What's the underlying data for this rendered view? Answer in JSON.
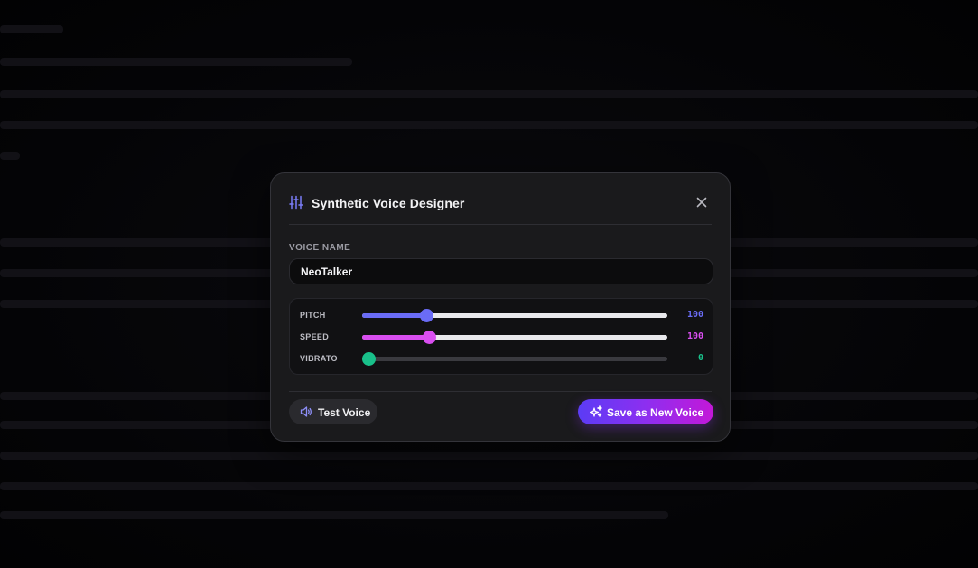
{
  "modal": {
    "title": "Synthetic Voice Designer",
    "title_icon": "sliders-icon",
    "close_icon": "close-icon"
  },
  "voice_name": {
    "label": "VOICE NAME",
    "value": "NeoTalker"
  },
  "sliders": [
    {
      "label": "PITCH",
      "value": "100",
      "level": 0.21,
      "color": "#6a6cf6"
    },
    {
      "label": "SPEED",
      "value": "100",
      "level": 0.22,
      "color": "#d94ef0"
    },
    {
      "label": "VIBRATO",
      "value": "0",
      "level": 0.0,
      "color": "#19c08a"
    }
  ],
  "actions": {
    "test_label": "Test Voice",
    "test_icon": "speaker-icon",
    "save_label": "Save as New Voice",
    "save_icon": "sparkles-icon"
  },
  "colors": {
    "accent_gradient_start": "#5b3cf5",
    "accent_gradient_end": "#c318d8",
    "pitch": "#6a6cf6",
    "speed": "#d94ef0",
    "vibrato": "#19c08a"
  }
}
